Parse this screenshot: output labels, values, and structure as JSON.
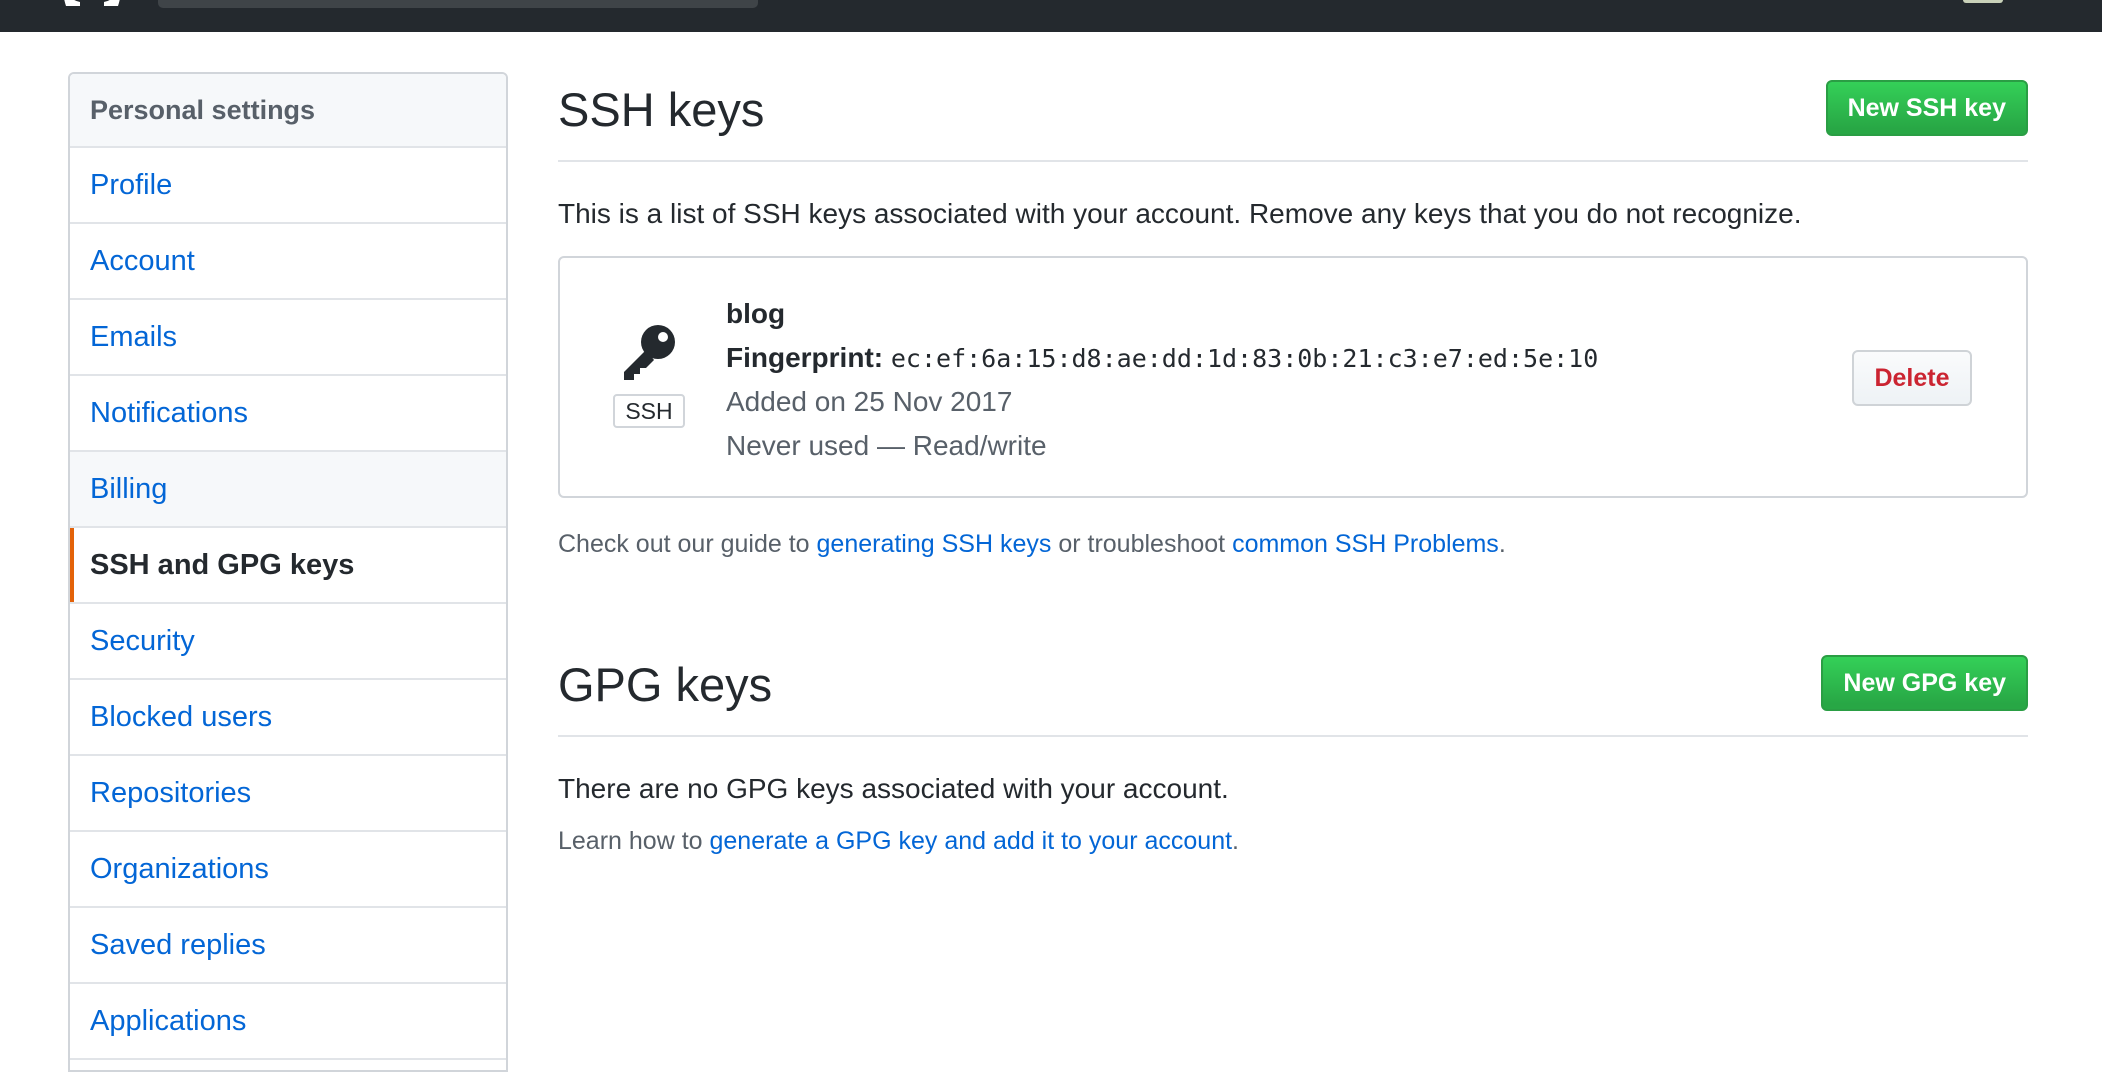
{
  "sidebar": {
    "header": "Personal settings",
    "items": [
      {
        "label": "Profile"
      },
      {
        "label": "Account"
      },
      {
        "label": "Emails"
      },
      {
        "label": "Notifications"
      },
      {
        "label": "Billing"
      },
      {
        "label": "SSH and GPG keys"
      },
      {
        "label": "Security"
      },
      {
        "label": "Blocked users"
      },
      {
        "label": "Repositories"
      },
      {
        "label": "Organizations"
      },
      {
        "label": "Saved replies"
      },
      {
        "label": "Applications"
      }
    ],
    "selected": "SSH and GPG keys",
    "accent_color": "#e36209"
  },
  "ssh": {
    "title": "SSH keys",
    "new_button": "New SSH key",
    "intro": "This is a list of SSH keys associated with your account. Remove any keys that you do not recognize.",
    "key": {
      "icon": "key-icon",
      "badge": "SSH",
      "name": "blog",
      "fingerprint_label": "Fingerprint:",
      "fingerprint": "ec:ef:6a:15:d8:ae:dd:1d:83:0b:21:c3:e7:ed:5e:10",
      "added": "Added on 25 Nov 2017",
      "usage": "Never used — Read/write",
      "delete_button": "Delete"
    },
    "guide": {
      "prefix": "Check out our guide to",
      "link1": "generating SSH keys",
      "middle": "or troubleshoot",
      "link2": "common SSH Problems",
      "suffix": "."
    }
  },
  "gpg": {
    "title": "GPG keys",
    "new_button": "New GPG key",
    "empty": "There are no GPG keys associated with your account.",
    "learn": {
      "prefix": "Learn how to",
      "link": "generate a GPG key and add it to your account",
      "suffix": "."
    }
  },
  "colors": {
    "topbar": "#24292e",
    "link": "#0366d6",
    "primary_button": "#28a745",
    "danger": "#cb2431"
  }
}
